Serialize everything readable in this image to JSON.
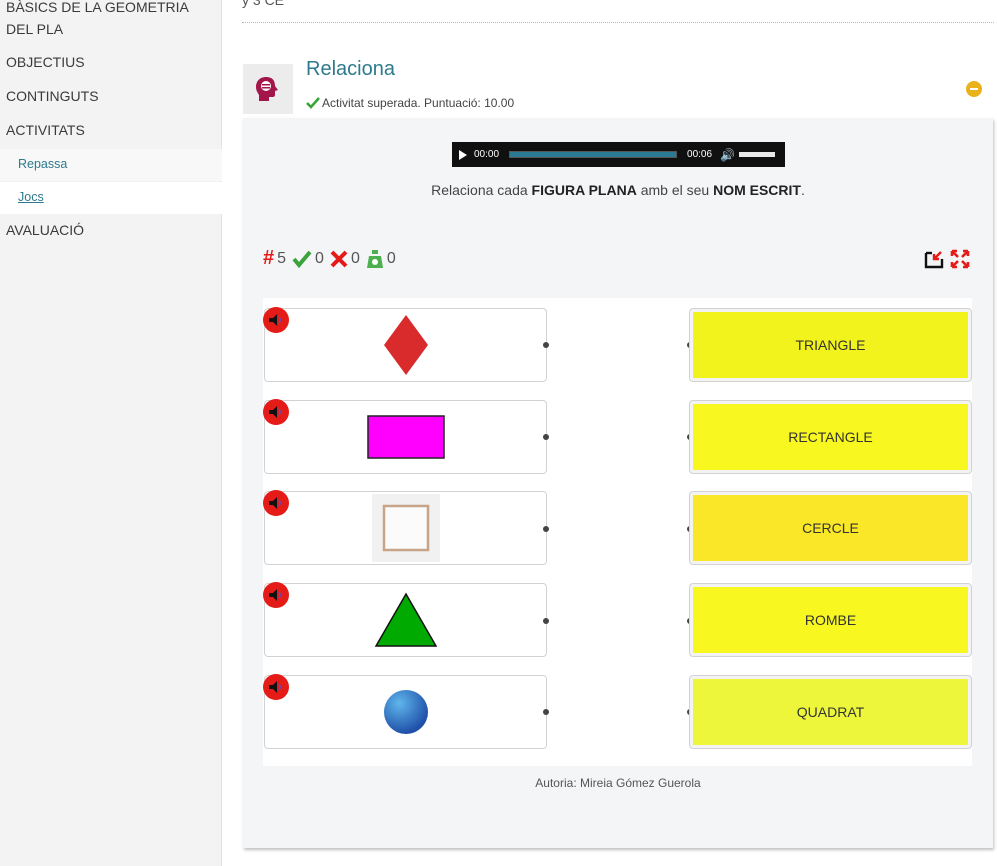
{
  "sidebar": {
    "title": "BÀSICS DE LA GEOMETRIA DEL PLA",
    "items": [
      {
        "label": "OBJECTIUS"
      },
      {
        "label": "CONTINGUTS"
      },
      {
        "label": "ACTIVITATS"
      },
      {
        "label": "AVALUACIÓ"
      }
    ],
    "subitems": [
      {
        "label": "Repassa"
      },
      {
        "label": "Jocs"
      }
    ]
  },
  "top_fragment": "y 3 CE",
  "activity": {
    "title": "Relaciona",
    "status": "Activitat superada. Puntuació: 10.00"
  },
  "audio": {
    "current_time": "00:00",
    "duration": "00:06"
  },
  "instruction": {
    "pre": "Relaciona cada ",
    "bold1": "FIGURA PLANA",
    "mid": " amb el seu ",
    "bold2": "NOM ESCRIT",
    "post": "."
  },
  "scores": {
    "total": "5",
    "correct": "0",
    "errors": "0",
    "attempts": "0"
  },
  "left_items": [
    {
      "shape": "diamond",
      "color": "#d92b2b"
    },
    {
      "shape": "rectangle",
      "color": "#ff00ff"
    },
    {
      "shape": "square",
      "color": "#c8a488"
    },
    {
      "shape": "triangle",
      "color": "#00aa00"
    },
    {
      "shape": "circle",
      "color": "#1f6fbf"
    }
  ],
  "right_items": [
    {
      "label": "TRIANGLE",
      "color": "#f2f21c"
    },
    {
      "label": "RECTANGLE",
      "color": "#f8f820"
    },
    {
      "label": "CERCLE",
      "color": "#fae728"
    },
    {
      "label": "ROMBE",
      "color": "#f8f820"
    },
    {
      "label": "QUADRAT",
      "color": "#eef63c"
    }
  ],
  "author": "Autoria: Mireia Gómez Guerola",
  "colors": {
    "accent": "#2d7a8c",
    "speaker": "#e41b17",
    "collapse": "#e9b11a"
  }
}
